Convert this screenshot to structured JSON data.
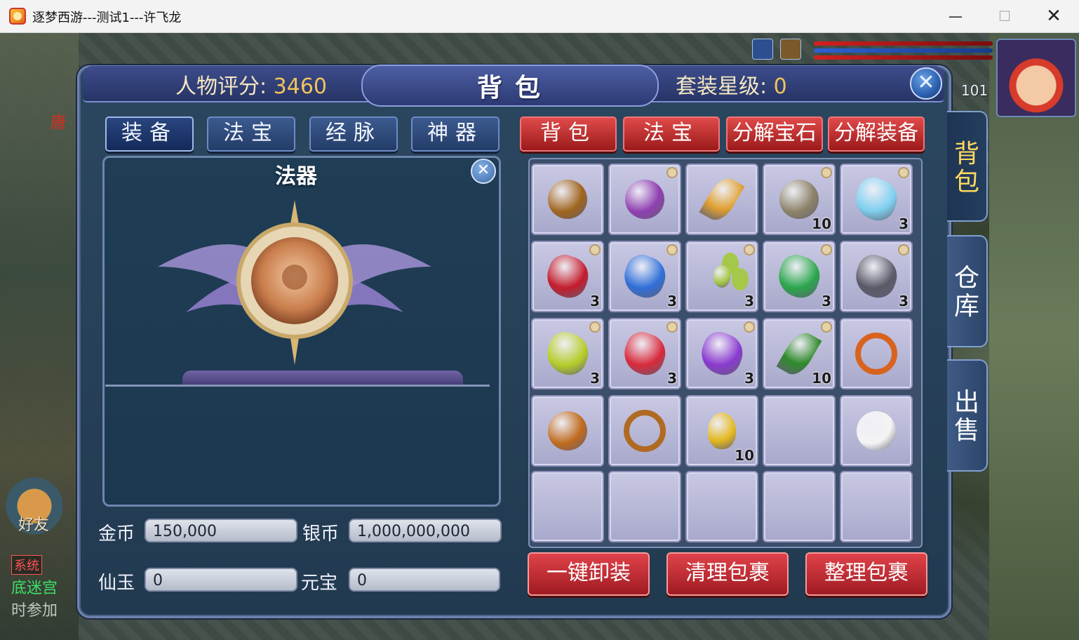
{
  "window": {
    "title": "逐梦西游---测试1---许飞龙",
    "minimize": "—",
    "maximize": "☐",
    "close": "✕"
  },
  "hud": {
    "level": "101",
    "left_tag": "唐",
    "friend_label": "好友",
    "chat_sys": "系统",
    "chat_line1": "底迷宫",
    "chat_line2": "时参加"
  },
  "header": {
    "score_label": "人物评分:",
    "score_value": "3460",
    "title": "背包",
    "suit_label": "套装星级:",
    "suit_value": "0",
    "close": "✕"
  },
  "left_tabs": [
    "装备",
    "法宝",
    "经脉",
    "神器"
  ],
  "right_tabs": [
    "背包",
    "法宝",
    "分解宝石",
    "分解装备"
  ],
  "equip": {
    "title": "法器",
    "close": "✕"
  },
  "currency": {
    "gold_label": "金币",
    "gold_value": "150,000",
    "silver_label": "银币",
    "silver_value": "1,000,000,000",
    "jade_label": "仙玉",
    "jade_value": "0",
    "ingot_label": "元宝",
    "ingot_value": "0"
  },
  "inventory": [
    {
      "item": "token-icon",
      "qty": "",
      "locked": false,
      "color": "#a0641e"
    },
    {
      "item": "pouch-icon",
      "qty": "",
      "locked": true,
      "color": "#8e3fb0"
    },
    {
      "item": "leaf-feather-icon",
      "qty": "",
      "locked": false,
      "color": "#e0a030"
    },
    {
      "item": "shell-icon",
      "qty": "10",
      "locked": true,
      "color": "#8c8268"
    },
    {
      "item": "ice-crystal-icon",
      "qty": "3",
      "locked": true,
      "color": "#7fd0f0"
    },
    {
      "item": "red-gem-icon",
      "qty": "3",
      "locked": true,
      "color": "#c41c2c"
    },
    {
      "item": "moon-gem-icon",
      "qty": "3",
      "locked": true,
      "color": "#2f6fd8"
    },
    {
      "item": "beans-icon",
      "qty": "3",
      "locked": true,
      "color": "#a6c84a"
    },
    {
      "item": "emerald-icon",
      "qty": "3",
      "locked": true,
      "color": "#2aa64c"
    },
    {
      "item": "dark-gem-icon",
      "qty": "3",
      "locked": true,
      "color": "#5a5a68"
    },
    {
      "item": "peridot-icon",
      "qty": "3",
      "locked": true,
      "color": "#b6cc2a"
    },
    {
      "item": "ruby-icon",
      "qty": "3",
      "locked": true,
      "color": "#d82a3c"
    },
    {
      "item": "amethyst-icon",
      "qty": "3",
      "locked": true,
      "color": "#8a3ad0"
    },
    {
      "item": "green-leaf-icon",
      "qty": "10",
      "locked": true,
      "color": "#2f8a2a"
    },
    {
      "item": "flower-ring-icon",
      "qty": "",
      "locked": false,
      "color": "#d8631e"
    },
    {
      "item": "amulet-icon",
      "qty": "",
      "locked": false,
      "color": "#c06a1e"
    },
    {
      "item": "ring-icon",
      "qty": "",
      "locked": false,
      "color": "#b06a22"
    },
    {
      "item": "gourd-icon",
      "qty": "10",
      "locked": false,
      "color": "#e4b81e"
    },
    {
      "item": "",
      "qty": "",
      "locked": false,
      "color": ""
    },
    {
      "item": "panda-icon",
      "qty": "",
      "locked": false,
      "color": "#f4f4f4"
    },
    {
      "item": "",
      "qty": "",
      "locked": false,
      "color": ""
    },
    {
      "item": "",
      "qty": "",
      "locked": false,
      "color": ""
    },
    {
      "item": "",
      "qty": "",
      "locked": false,
      "color": ""
    },
    {
      "item": "",
      "qty": "",
      "locked": false,
      "color": ""
    },
    {
      "item": "",
      "qty": "",
      "locked": false,
      "color": ""
    }
  ],
  "actions": {
    "unequip_all": "一键卸装",
    "clear_bag": "清理包裹",
    "sort_bag": "整理包裹"
  },
  "side_tabs": [
    "背包",
    "仓库",
    "出售"
  ],
  "colors": {
    "accent_red": "#c0222c",
    "panel_blue": "#223a50",
    "slot_lavender": "#b8b8d8"
  }
}
